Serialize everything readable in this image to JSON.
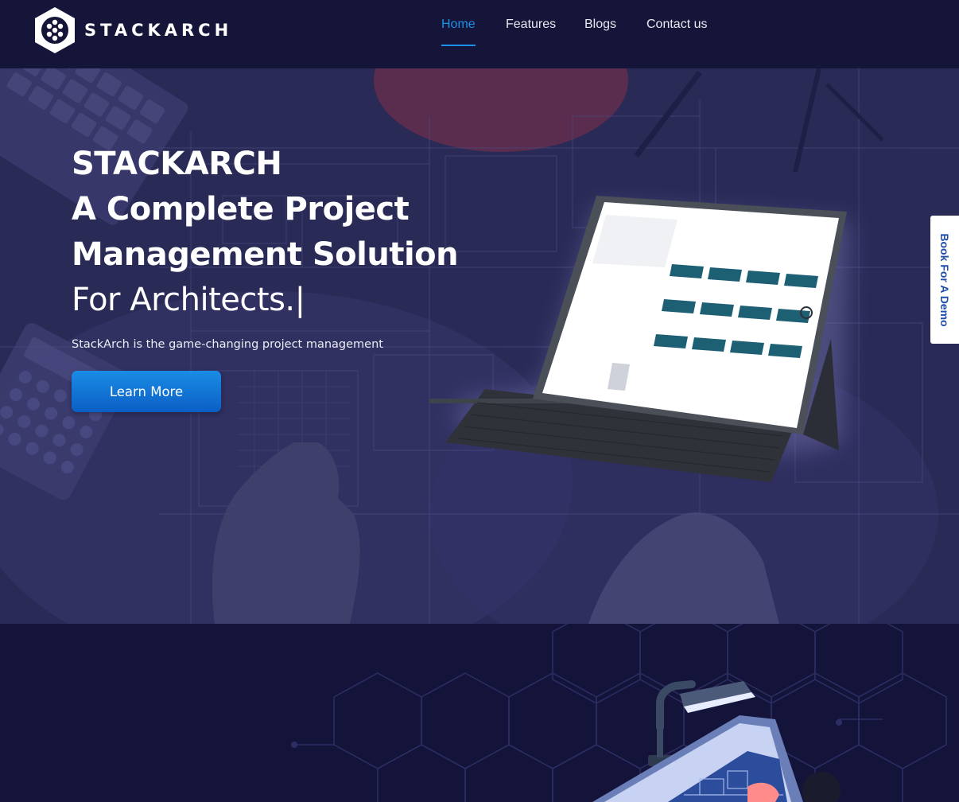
{
  "brand": {
    "name": "STACKARCH"
  },
  "nav": {
    "items": [
      {
        "label": "Home",
        "active": true
      },
      {
        "label": "Features",
        "active": false
      },
      {
        "label": "Blogs",
        "active": false
      },
      {
        "label": "Contact us",
        "active": false
      }
    ]
  },
  "hero": {
    "title_lines": [
      "STACKARCH",
      "A Complete Project",
      "Management Solution",
      "For Architects."
    ],
    "typing_cursor": "|",
    "subtitle": "StackArch is the game-changing project management",
    "cta_label": "Learn More"
  },
  "demo_tab": {
    "label": "Book For A Demo"
  },
  "colors": {
    "nav_bg": "#151539",
    "accent": "#1b90e8",
    "hero_overlay": "#2a2a57",
    "section_bg": "#14143a",
    "button": "#1a8ce6"
  },
  "icons": [
    "stackarch-logo-icon",
    "tablet-illustration",
    "architect-illustration"
  ]
}
